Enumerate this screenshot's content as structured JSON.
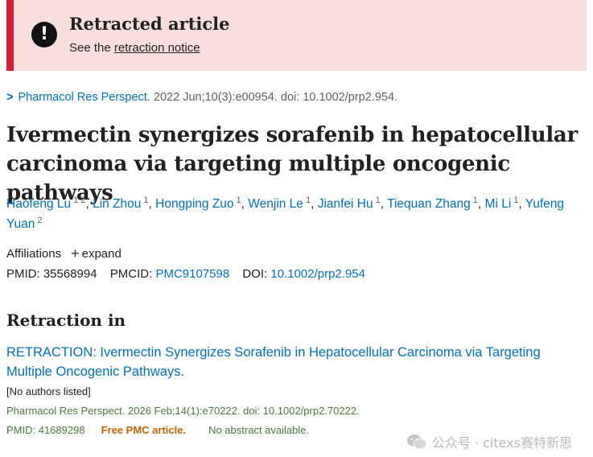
{
  "banner": {
    "icon": "exclamation-circle-icon",
    "title": "Retracted article",
    "sub_prefix": "See the",
    "sub_link": "retraction notice",
    "colors": {
      "background": "#f9dede",
      "border": "#d21f3a"
    }
  },
  "citation": {
    "journal": "Pharmacol Res Perspect.",
    "details": "2022 Jun;10(3):e00954. doi: 10.1002/prp2.954."
  },
  "article": {
    "title": "Ivermectin synergizes sorafenib in hepatocellular carcinoma via targeting multiple oncogenic pathways"
  },
  "authors": [
    {
      "name": "Haofeng Lu",
      "sup": "1 2"
    },
    {
      "name": "Lin Zhou",
      "sup": "1"
    },
    {
      "name": "Hongping Zuo",
      "sup": "1"
    },
    {
      "name": "Wenjin Le",
      "sup": "1"
    },
    {
      "name": "Jianfei Hu",
      "sup": "1"
    },
    {
      "name": "Tiequan Zhang",
      "sup": "1"
    },
    {
      "name": "Mi Li",
      "sup": "1"
    },
    {
      "name": "Yufeng Yuan",
      "sup": "2"
    }
  ],
  "affiliations": {
    "label": "Affiliations",
    "expand": "expand"
  },
  "ids": {
    "pmid_label": "PMID:",
    "pmid": "35568994",
    "pmcid_label": "PMCID:",
    "pmcid": "PMC9107598",
    "doi_label": "DOI:",
    "doi": "10.1002/prp2.954"
  },
  "retraction": {
    "heading": "Retraction in",
    "title": "RETRACTION: Ivermectin Synergizes Sorafenib in Hepatocellular Carcinoma via Targeting Multiple Oncogenic Pathways.",
    "authors": "[No authors listed]",
    "citation": "Pharmacol Res Perspect. 2026 Feb;14(1):e70222. doi: 10.1002/prp2.70222.",
    "pmid": "PMID: 41689298",
    "free": "Free PMC article.",
    "no_abstract": "No abstract available."
  },
  "watermark": {
    "icon": "wechat-icon",
    "text": "公众号 · citexs赛特新思"
  }
}
